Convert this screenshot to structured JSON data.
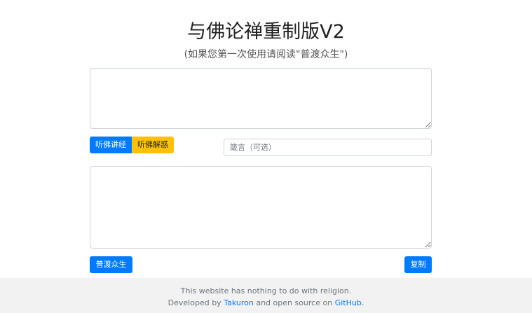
{
  "header": {
    "title": "与佛论禅重制版V2",
    "subtitle": "(如果您第一次使用请阅读\"普渡众生\")"
  },
  "input": {
    "value": "",
    "placeholder": ""
  },
  "actions": {
    "listen_sutra_label": "听佛讲经",
    "listen_resolve_label": "听佛解惑",
    "keyword_placeholder": "箴言（可选）",
    "keyword_value": ""
  },
  "output": {
    "value": "",
    "placeholder": ""
  },
  "bottom_actions": {
    "save_all_label": "普渡众生",
    "copy_label": "复制"
  },
  "footer": {
    "line1": "This website has nothing to do with religion.",
    "line2_prefix": "Developed by ",
    "author_link": "Takuron",
    "line2_middle": " and open source on ",
    "github_link": "GitHub",
    "line2_suffix": "."
  },
  "colors": {
    "primary": "#007bff",
    "warning": "#ffc107",
    "footer_bg": "#f2f2f2"
  }
}
